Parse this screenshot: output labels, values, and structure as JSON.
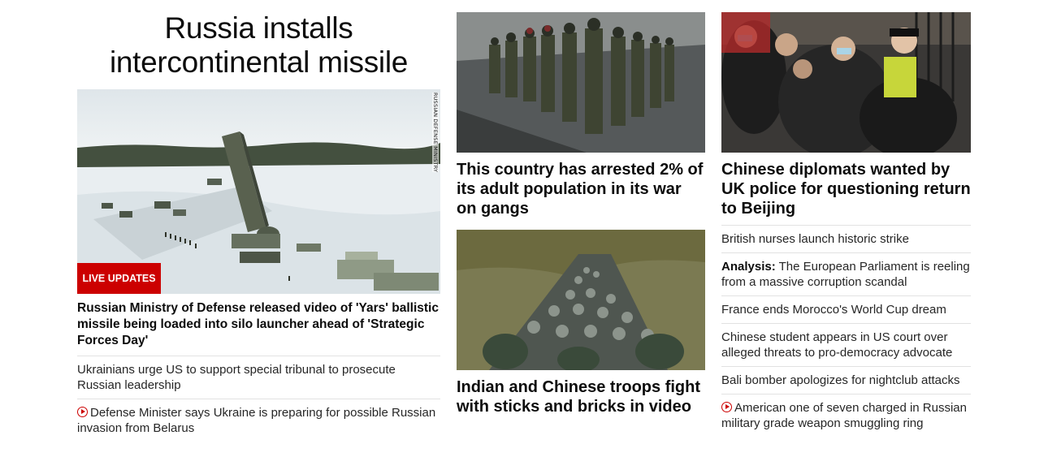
{
  "colors": {
    "accent_red": "#cc0000",
    "text": "#0c0c0c",
    "divider": "#e2e2e2"
  },
  "lead": {
    "headline": "Russia installs intercontinental missile",
    "image_credit": "RUSSIAN DEFENSE MINISTRY",
    "badge": "LIVE UPDATES",
    "caption": "Russian Ministry of Defense released video of 'Yars' ballistic missile being loaded into silo launcher ahead of 'Strategic Forces Day'",
    "related": [
      {
        "text": "Ukrainians urge US to support special tribunal to prosecute Russian leadership",
        "icon": ""
      },
      {
        "text": "Defense Minister says Ukraine is preparing for possible Russian invasion from Belarus",
        "icon": "play-icon"
      }
    ]
  },
  "middle": {
    "stories": [
      {
        "title": "This country has arrested 2% of its adult population in its war on gangs"
      },
      {
        "title": "Indian and Chinese troops fight with sticks and bricks in video"
      }
    ]
  },
  "right": {
    "feature_title": "Chinese diplomats wanted by UK police for questioning return to Beijing",
    "list": [
      {
        "label": "",
        "text": "British nurses launch historic strike"
      },
      {
        "label": "Analysis:",
        "text": "The European Parliament is reeling from a massive corruption scandal"
      },
      {
        "label": "",
        "text": "France ends Morocco's World Cup dream"
      },
      {
        "label": "",
        "text": "Chinese student appears in US court over alleged threats to pro-democracy advocate"
      },
      {
        "label": "",
        "text": "Bali bomber apologizes for nightclub attacks"
      },
      {
        "label": "",
        "text": "American one of seven charged in Russian military grade weapon smuggling ring",
        "icon": "play-icon"
      }
    ]
  }
}
